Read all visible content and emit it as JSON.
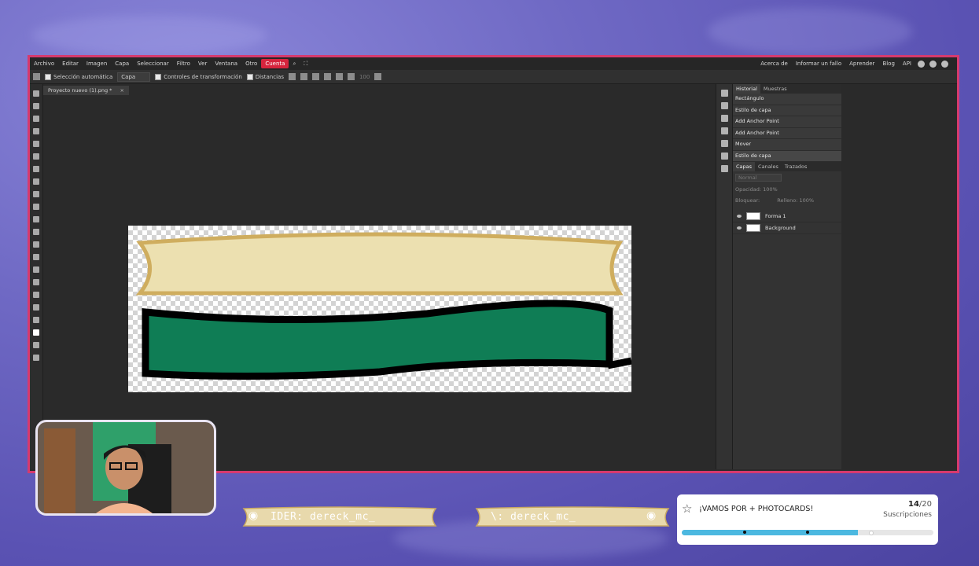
{
  "menu": {
    "items": [
      "Archivo",
      "Editar",
      "Imagen",
      "Capa",
      "Seleccionar",
      "Filtro",
      "Ver",
      "Ventana",
      "Otro",
      "Cuenta"
    ],
    "right_links": [
      "Acerca de",
      "Informar un fallo",
      "Aprender",
      "Blog",
      "API"
    ]
  },
  "options": {
    "auto_select": "Selección automática",
    "target": "Capa",
    "transform_controls": "Controles de transformación",
    "distances": "Distancias",
    "zoom": "100"
  },
  "document": {
    "tab_title": "Proyecto nuevo (1).png *",
    "close": "×"
  },
  "history": {
    "tabs": [
      "Historial",
      "Muestras"
    ],
    "items": [
      "Rectángulo",
      "Estilo de capa",
      "Add Anchor Point",
      "Add Anchor Point",
      "Mover",
      "Estilo de capa"
    ]
  },
  "layers": {
    "tabs": [
      "Capas",
      "Canales",
      "Trazados"
    ],
    "blend_mode": "Normal",
    "opacity_label": "Opacidad:",
    "opacity": "100%",
    "lock_label": "Bloquear:",
    "fill_label": "Relleno:",
    "fill": "100%",
    "items": [
      "Forma 1",
      "Background"
    ]
  },
  "colors": {
    "frame": "#d63a6e",
    "cream": "#ece0b0",
    "gold": "#cfad5e",
    "green": "#0f7d55",
    "accent": "#d6243d",
    "progress": "#4cb8e0"
  },
  "overlay": {
    "banner_left": "IDER: dereck_mc_",
    "banner_right": "\\: dereck_mc_",
    "goal_title": "¡VAMOS POR + PHOTOCARDS!",
    "goal_current": "14",
    "goal_total": "/20",
    "goal_label": "Suscripciones",
    "goal_progress": 0.7
  }
}
